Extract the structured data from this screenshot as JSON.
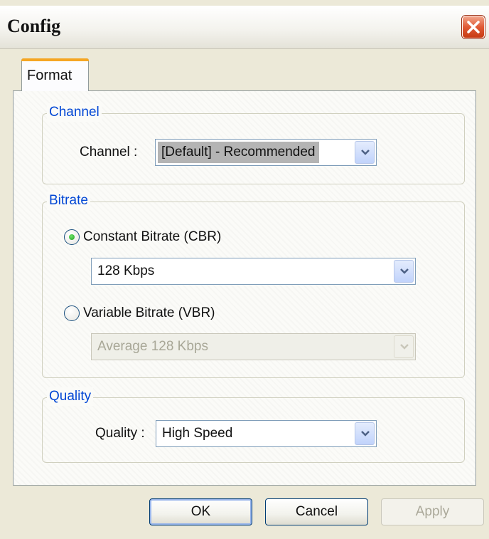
{
  "window": {
    "title": "Config"
  },
  "tabs": [
    {
      "label": "Format",
      "selected": true
    }
  ],
  "channel_group": {
    "legend": "Channel",
    "label": "Channel :",
    "select_value": "[Default] - Recommended"
  },
  "bitrate_group": {
    "legend": "Bitrate",
    "cbr_label": "Constant Bitrate (CBR)",
    "cbr_selected": true,
    "cbr_value": "128 Kbps",
    "vbr_label": "Variable Bitrate (VBR)",
    "vbr_selected": false,
    "vbr_value": "Average 128 Kbps"
  },
  "quality_group": {
    "legend": "Quality",
    "label": "Quality :",
    "select_value": "High Speed"
  },
  "buttons": {
    "ok": "OK",
    "cancel": "Cancel",
    "apply": "Apply"
  },
  "icons": {
    "close": "close-icon",
    "dropdown": "chevron-down-icon",
    "radio_on": "radio-selected-icon",
    "radio_off": "radio-unselected-icon"
  },
  "colors": {
    "legend_text": "#0046d5",
    "close_button": "#e05a35",
    "tab_highlight": "#f5a623",
    "dialog_background": "#ece9d8"
  }
}
